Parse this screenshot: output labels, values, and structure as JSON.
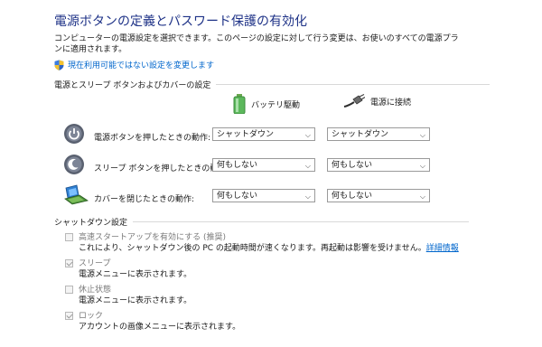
{
  "page": {
    "title": "電源ボタンの定義とパスワード保護の有効化",
    "description": "コンピューターの電源設定を選択できます。このページの設定に対して行う変更は、お使いのすべての電源プランに適用されます。",
    "change_link": "現在利用可能ではない設定を変更します"
  },
  "power_section": {
    "heading": "電源とスリープ ボタンおよびカバーの設定",
    "battery_label": "バッテリ駆動",
    "plugged_label": "電源に接続",
    "rows": [
      {
        "label": "電源ボタンを押したときの動作:",
        "battery": "シャットダウン",
        "plugged": "シャットダウン",
        "icon": "power-button-icon"
      },
      {
        "label": "スリープ ボタンを押したときの動作:",
        "battery": "何もしない",
        "plugged": "何もしない",
        "icon": "sleep-button-icon"
      },
      {
        "label": "カバーを閉じたときの動作:",
        "battery": "何もしない",
        "plugged": "何もしない",
        "icon": "laptop-lid-icon"
      }
    ]
  },
  "shutdown_section": {
    "heading": "シャットダウン設定",
    "items": [
      {
        "title": "高速スタートアップを有効にする (推奨)",
        "desc": "これにより、シャットダウン後の PC の起動時間が速くなります。再起動は影響を受けません。",
        "link": "詳細情報",
        "checked": false
      },
      {
        "title": "スリープ",
        "desc": "電源メニューに表示されます。",
        "checked": true
      },
      {
        "title": "休止状態",
        "desc": "電源メニューに表示されます。",
        "checked": false
      },
      {
        "title": "ロック",
        "desc": "アカウントの画像メニューに表示されます。",
        "checked": true
      }
    ]
  },
  "colors": {
    "title": "#1e3287",
    "link": "#0066cc",
    "disabled_text": "#7a7a7a"
  }
}
